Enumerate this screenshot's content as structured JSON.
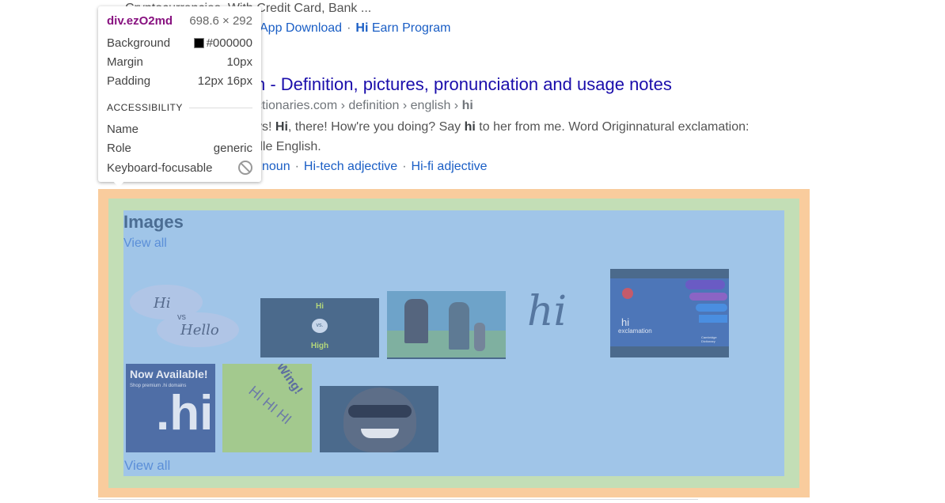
{
  "result1": {
    "snippet_cut": "Cryptocurrencies. With Credit Card, Bank ...",
    "sitelinks": [
      "App Download",
      "Earn Program"
    ],
    "sitelink2_bold": "Hi"
  },
  "result2": {
    "title": "h - Definition, pictures, pronunciation and usage notes",
    "url_host": "ctionaries.com",
    "url_path": [
      "definition",
      "english"
    ],
    "url_last": "hi",
    "snippet_line1_a": "ys! ",
    "snippet_line1_b1": "Hi",
    "snippet_line1_c": ", there! How're you doing? Say ",
    "snippet_line1_b2": "hi",
    "snippet_line1_d": " to her from me. Word Originnatural exclamation:",
    "snippet_line2": "dle English.",
    "sublinks": [
      "noun",
      "Hi-tech adjective",
      "Hi-fi adjective"
    ]
  },
  "images": {
    "heading": "Images",
    "view_all_top": "View all",
    "view_all_bottom": "View all",
    "thumbs": {
      "t1_text1": "Hi",
      "t1_text2": "vs",
      "t1_text3": "Hello",
      "t2_text1": "Hi",
      "t2_text2": "vs.",
      "t2_text3": "High",
      "t4_text": "hi",
      "t5_text1": "hi",
      "t5_text2": "exclamation",
      "t5_text3": "Cambridge Dictionary",
      "t6_text1": "Now Available!",
      "t6_text2": "Shop premium .hi domains",
      "t6_text3": ".hi",
      "t7_text1": "Wing!",
      "t7_text2": "HI HI HI"
    }
  },
  "tooltip": {
    "selector": "div.ezO2md",
    "size": "698.6 × 292",
    "rows": [
      {
        "label": "Background",
        "value": "#000000"
      },
      {
        "label": "Margin",
        "value": "10px"
      },
      {
        "label": "Padding",
        "value": "12px 16px"
      }
    ],
    "section": "ACCESSIBILITY",
    "acc_rows": [
      {
        "label": "Name",
        "value": ""
      },
      {
        "label": "Role",
        "value": "generic"
      },
      {
        "label": "Keyboard-focusable",
        "value": ""
      }
    ],
    "swatch_color": "#000000"
  },
  "colors": {
    "margin_overlay": "#f9cc9d",
    "border_overlay": "#c3deb6",
    "content_overlay": "#a0c5e8",
    "link": "#1a0dab"
  }
}
